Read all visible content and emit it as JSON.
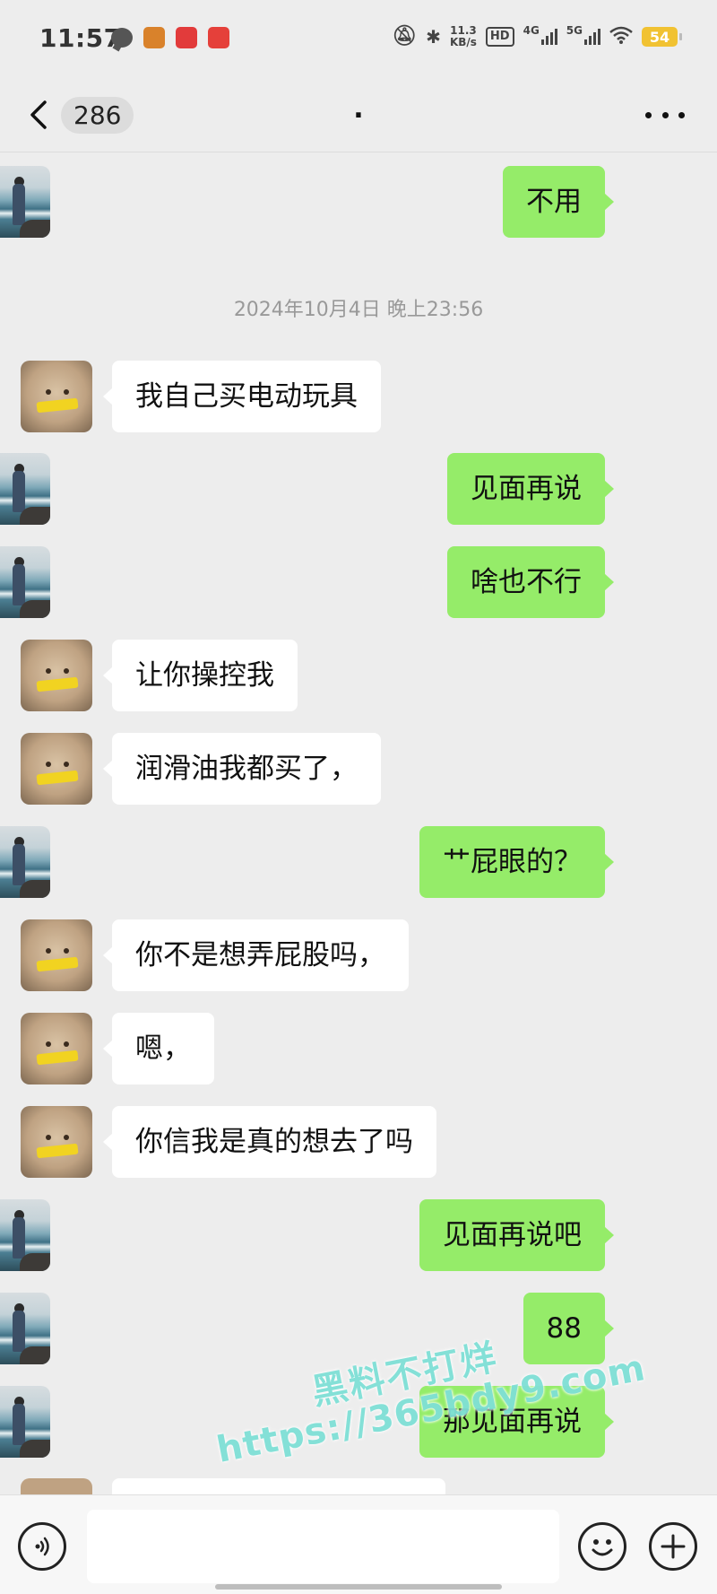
{
  "status_bar": {
    "time": "11:57",
    "net_speed_value": "11.3",
    "net_speed_unit": "KB/s",
    "hd_label": "HD",
    "net1": "4G",
    "net2": "5G",
    "battery": "54",
    "icons": [
      "chat-notification-icon",
      "game-app-icon",
      "flower-app-icon",
      "red-app-icon",
      "mute-icon",
      "bluetooth-icon",
      "wifi-icon"
    ]
  },
  "nav": {
    "unread_count": "286",
    "title": ".",
    "icons": [
      "back-chevron-icon",
      "more-dots-icon"
    ]
  },
  "timestamp": "2024年10月4日 晚上23:56",
  "messages": [
    {
      "side": "right",
      "text": "不用"
    },
    {
      "side": "left",
      "text": "我自己买电动玩具"
    },
    {
      "side": "right",
      "text": "见面再说"
    },
    {
      "side": "right",
      "text": "啥也不行"
    },
    {
      "side": "left",
      "text": "让你操控我"
    },
    {
      "side": "left",
      "text": "润滑油我都买了，"
    },
    {
      "side": "right",
      "text": "艹屁眼的？"
    },
    {
      "side": "left",
      "text": "你不是想弄屁股吗，"
    },
    {
      "side": "left",
      "text": "嗯，"
    },
    {
      "side": "left",
      "text": "你信我是真的想去了吗"
    },
    {
      "side": "right",
      "text": "见面再说吧"
    },
    {
      "side": "right",
      "text": "88"
    },
    {
      "side": "right",
      "text": "那见面再说"
    }
  ],
  "watermark": {
    "line1": "黑料不打烊",
    "line2": "https://365bdy9.com"
  },
  "input": {
    "placeholder": "",
    "icons": [
      "voice-icon",
      "emoji-icon",
      "plus-icon"
    ]
  },
  "colors": {
    "sent_bubble": "#95ec69",
    "received_bubble": "#ffffff",
    "background": "#ededed"
  }
}
